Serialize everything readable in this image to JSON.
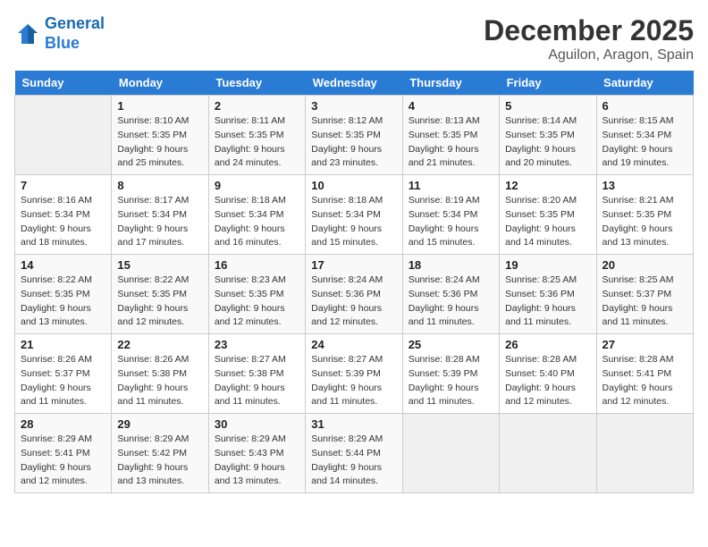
{
  "header": {
    "logo_line1": "General",
    "logo_line2": "Blue",
    "month": "December 2025",
    "location": "Aguilon, Aragon, Spain"
  },
  "weekdays": [
    "Sunday",
    "Monday",
    "Tuesday",
    "Wednesday",
    "Thursday",
    "Friday",
    "Saturday"
  ],
  "weeks": [
    [
      {
        "day": "",
        "info": ""
      },
      {
        "day": "1",
        "info": "Sunrise: 8:10 AM\nSunset: 5:35 PM\nDaylight: 9 hours\nand 25 minutes."
      },
      {
        "day": "2",
        "info": "Sunrise: 8:11 AM\nSunset: 5:35 PM\nDaylight: 9 hours\nand 24 minutes."
      },
      {
        "day": "3",
        "info": "Sunrise: 8:12 AM\nSunset: 5:35 PM\nDaylight: 9 hours\nand 23 minutes."
      },
      {
        "day": "4",
        "info": "Sunrise: 8:13 AM\nSunset: 5:35 PM\nDaylight: 9 hours\nand 21 minutes."
      },
      {
        "day": "5",
        "info": "Sunrise: 8:14 AM\nSunset: 5:35 PM\nDaylight: 9 hours\nand 20 minutes."
      },
      {
        "day": "6",
        "info": "Sunrise: 8:15 AM\nSunset: 5:34 PM\nDaylight: 9 hours\nand 19 minutes."
      }
    ],
    [
      {
        "day": "7",
        "info": "Sunrise: 8:16 AM\nSunset: 5:34 PM\nDaylight: 9 hours\nand 18 minutes."
      },
      {
        "day": "8",
        "info": "Sunrise: 8:17 AM\nSunset: 5:34 PM\nDaylight: 9 hours\nand 17 minutes."
      },
      {
        "day": "9",
        "info": "Sunrise: 8:18 AM\nSunset: 5:34 PM\nDaylight: 9 hours\nand 16 minutes."
      },
      {
        "day": "10",
        "info": "Sunrise: 8:18 AM\nSunset: 5:34 PM\nDaylight: 9 hours\nand 15 minutes."
      },
      {
        "day": "11",
        "info": "Sunrise: 8:19 AM\nSunset: 5:34 PM\nDaylight: 9 hours\nand 15 minutes."
      },
      {
        "day": "12",
        "info": "Sunrise: 8:20 AM\nSunset: 5:35 PM\nDaylight: 9 hours\nand 14 minutes."
      },
      {
        "day": "13",
        "info": "Sunrise: 8:21 AM\nSunset: 5:35 PM\nDaylight: 9 hours\nand 13 minutes."
      }
    ],
    [
      {
        "day": "14",
        "info": "Sunrise: 8:22 AM\nSunset: 5:35 PM\nDaylight: 9 hours\nand 13 minutes."
      },
      {
        "day": "15",
        "info": "Sunrise: 8:22 AM\nSunset: 5:35 PM\nDaylight: 9 hours\nand 12 minutes."
      },
      {
        "day": "16",
        "info": "Sunrise: 8:23 AM\nSunset: 5:35 PM\nDaylight: 9 hours\nand 12 minutes."
      },
      {
        "day": "17",
        "info": "Sunrise: 8:24 AM\nSunset: 5:36 PM\nDaylight: 9 hours\nand 12 minutes."
      },
      {
        "day": "18",
        "info": "Sunrise: 8:24 AM\nSunset: 5:36 PM\nDaylight: 9 hours\nand 11 minutes."
      },
      {
        "day": "19",
        "info": "Sunrise: 8:25 AM\nSunset: 5:36 PM\nDaylight: 9 hours\nand 11 minutes."
      },
      {
        "day": "20",
        "info": "Sunrise: 8:25 AM\nSunset: 5:37 PM\nDaylight: 9 hours\nand 11 minutes."
      }
    ],
    [
      {
        "day": "21",
        "info": "Sunrise: 8:26 AM\nSunset: 5:37 PM\nDaylight: 9 hours\nand 11 minutes."
      },
      {
        "day": "22",
        "info": "Sunrise: 8:26 AM\nSunset: 5:38 PM\nDaylight: 9 hours\nand 11 minutes."
      },
      {
        "day": "23",
        "info": "Sunrise: 8:27 AM\nSunset: 5:38 PM\nDaylight: 9 hours\nand 11 minutes."
      },
      {
        "day": "24",
        "info": "Sunrise: 8:27 AM\nSunset: 5:39 PM\nDaylight: 9 hours\nand 11 minutes."
      },
      {
        "day": "25",
        "info": "Sunrise: 8:28 AM\nSunset: 5:39 PM\nDaylight: 9 hours\nand 11 minutes."
      },
      {
        "day": "26",
        "info": "Sunrise: 8:28 AM\nSunset: 5:40 PM\nDaylight: 9 hours\nand 12 minutes."
      },
      {
        "day": "27",
        "info": "Sunrise: 8:28 AM\nSunset: 5:41 PM\nDaylight: 9 hours\nand 12 minutes."
      }
    ],
    [
      {
        "day": "28",
        "info": "Sunrise: 8:29 AM\nSunset: 5:41 PM\nDaylight: 9 hours\nand 12 minutes."
      },
      {
        "day": "29",
        "info": "Sunrise: 8:29 AM\nSunset: 5:42 PM\nDaylight: 9 hours\nand 13 minutes."
      },
      {
        "day": "30",
        "info": "Sunrise: 8:29 AM\nSunset: 5:43 PM\nDaylight: 9 hours\nand 13 minutes."
      },
      {
        "day": "31",
        "info": "Sunrise: 8:29 AM\nSunset: 5:44 PM\nDaylight: 9 hours\nand 14 minutes."
      },
      {
        "day": "",
        "info": ""
      },
      {
        "day": "",
        "info": ""
      },
      {
        "day": "",
        "info": ""
      }
    ]
  ]
}
